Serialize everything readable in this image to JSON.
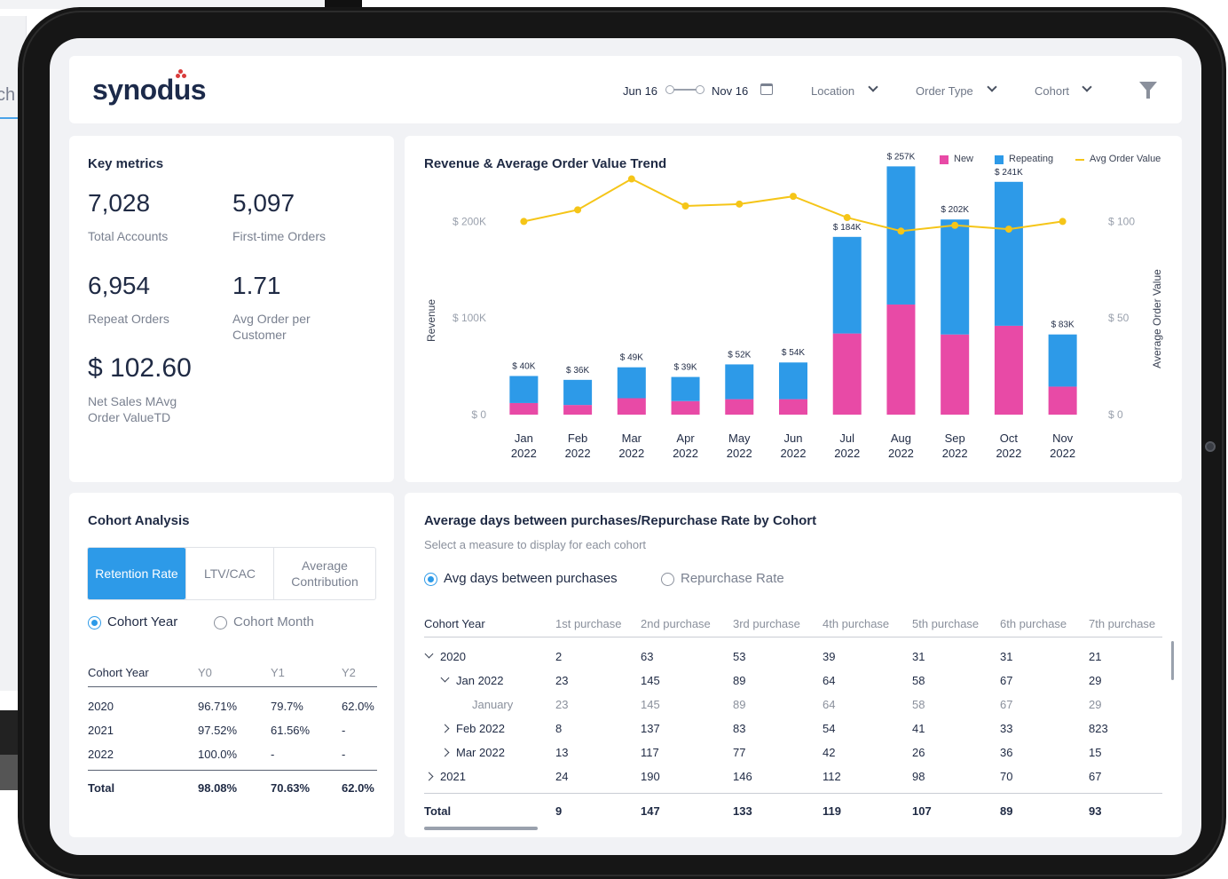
{
  "background": {
    "left_text": "ch"
  },
  "header": {
    "logo": "synodus",
    "date_start": "Jun 16",
    "date_end": "Nov 16",
    "filters": [
      "Location",
      "Order Type",
      "Cohort"
    ]
  },
  "key_metrics": {
    "title": "Key metrics",
    "items": [
      {
        "value": "7,028",
        "label": "Total Accounts"
      },
      {
        "value": "5,097",
        "label": "First-time Orders"
      },
      {
        "value": "6,954",
        "label": "Repeat Orders"
      },
      {
        "value": "1.71",
        "label": "Avg Order per Customer"
      },
      {
        "value": "$ 102.60",
        "label": "Net Sales MAvg Order ValueTD"
      }
    ]
  },
  "chart_data": {
    "type": "bar",
    "title": "Revenue & Average Order Value Trend",
    "ylabel": "Revenue",
    "y2label": "Average Order Value",
    "categories": [
      "Jan 2022",
      "Feb 2022",
      "Mar 2022",
      "Apr 2022",
      "May 2022",
      "Jun 2022",
      "Jul 2022",
      "Aug 2022",
      "Sep 2022",
      "Oct 2022",
      "Nov 2022"
    ],
    "ylim": [
      0,
      250000
    ],
    "y_ticks": [
      "$ 0",
      "$ 100K",
      "$ 200K"
    ],
    "y2lim": [
      0,
      100
    ],
    "y2_ticks": [
      "$ 0",
      "$ 50",
      "$ 100"
    ],
    "stacked": true,
    "series": [
      {
        "name": "New",
        "color": "#e84aa6",
        "values": [
          12000,
          10000,
          17000,
          14000,
          16000,
          16000,
          84000,
          114000,
          83000,
          92000,
          29000
        ]
      },
      {
        "name": "Repeating",
        "color": "#2d9ae8",
        "values": [
          28000,
          26000,
          32000,
          25000,
          36000,
          38000,
          100000,
          143000,
          119000,
          149000,
          54000
        ]
      },
      {
        "name": "Avg Order Value",
        "color": "#f5c518",
        "type": "line",
        "values": [
          100,
          106,
          122,
          108,
          109,
          113,
          102,
          95,
          98,
          96,
          100
        ]
      }
    ],
    "data_labels": [
      "$ 40K",
      "$ 36K",
      "$ 49K",
      "$ 39K",
      "$ 52K",
      "$ 54K",
      "$ 184K",
      "$ 257K",
      "$ 202K",
      "$ 241K",
      "$ 83K"
    ],
    "legend": "top-right",
    "grid": false
  },
  "cohort_analysis": {
    "title": "Cohort Analysis",
    "tabs": [
      "Retention Rate",
      "LTV/CAC",
      "Average Contribution"
    ],
    "radio": [
      "Cohort Year",
      "Cohort Month"
    ],
    "headers": [
      "Cohort Year",
      "Y0",
      "Y1",
      "Y2"
    ],
    "rows": [
      [
        "2020",
        "96.71%",
        "79.7%",
        "62.0%"
      ],
      [
        "2021",
        "97.52%",
        "61.56%",
        "-"
      ],
      [
        "2022",
        "100.0%",
        "-",
        "-"
      ]
    ],
    "total": [
      "Total",
      "98.08%",
      "70.63%",
      "62.0%"
    ]
  },
  "repurchase": {
    "title": "Average days between purchases/Repurchase Rate by Cohort",
    "subtitle": "Select a measure to display for each cohort",
    "radio": [
      "Avg days between purchases",
      "Repurchase Rate"
    ],
    "headers": [
      "Cohort Year",
      "1st purchase",
      "2nd purchase",
      "3rd purchase",
      "4th purchase",
      "5th purchase",
      "6th purchase",
      "7th purchase"
    ],
    "rows": [
      {
        "label": "2020",
        "values": [
          "2",
          "63",
          "53",
          "39",
          "31",
          "31",
          "21"
        ]
      },
      {
        "label": "Jan 2022",
        "values": [
          "23",
          "145",
          "89",
          "64",
          "58",
          "67",
          "29"
        ]
      },
      {
        "label": "January",
        "values": [
          "23",
          "145",
          "89",
          "64",
          "58",
          "67",
          "29"
        ]
      },
      {
        "label": "Feb 2022",
        "values": [
          "8",
          "137",
          "83",
          "54",
          "41",
          "33",
          "823"
        ]
      },
      {
        "label": "Mar 2022",
        "values": [
          "13",
          "117",
          "77",
          "42",
          "26",
          "36",
          "15"
        ]
      },
      {
        "label": "2021",
        "values": [
          "24",
          "190",
          "146",
          "112",
          "98",
          "70",
          "67"
        ]
      }
    ],
    "total": {
      "label": "Total",
      "values": [
        "9",
        "147",
        "133",
        "119",
        "107",
        "89",
        "93"
      ]
    }
  }
}
